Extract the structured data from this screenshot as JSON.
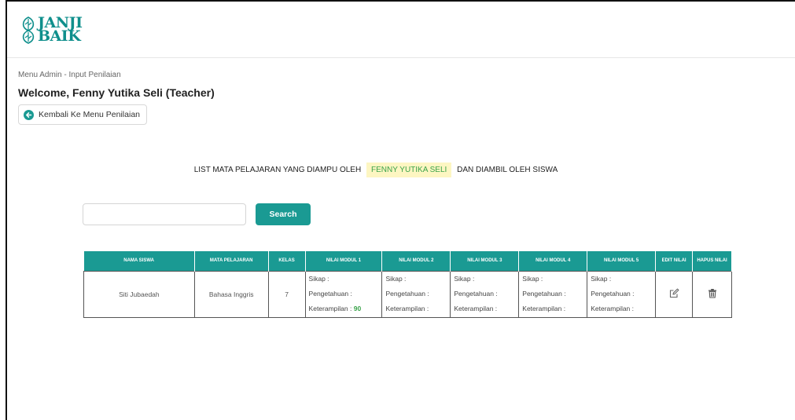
{
  "logo": {
    "line1": "JANJI",
    "line2": "BAIK"
  },
  "breadcrumb": "Menu Admin - Input Penilaian",
  "welcome": "Welcome, Fenny Yutika Seli (Teacher)",
  "back_button": {
    "label": "Kembali Ke Menu Penilaian",
    "icon": "arrow-left-circle-icon"
  },
  "list_title": {
    "prefix": "LIST MATA PELAJARAN YANG DIAMPU OLEH",
    "teacher": "FENNY YUTIKA SELI",
    "suffix": "DAN DIAMBIL OLEH SISWA"
  },
  "search": {
    "placeholder": "",
    "button_label": "Search"
  },
  "table": {
    "headers": [
      "NAMA SISWA",
      "MATA PELAJARAN",
      "KELAS",
      "NILAI MODUL 1",
      "NILAI MODUL 2",
      "NILAI MODUL 3",
      "NILAI MODUL 4",
      "NILAI MODUL 5",
      "EDIT NILAI",
      "HAPUS NILAI"
    ],
    "rows": [
      {
        "nama": "Siti Jubaedah",
        "mapel": "Bahasa Inggris",
        "kelas": "7",
        "modul": [
          {
            "sikap": "Sikap :",
            "pengetahuan": "Pengetahuan :",
            "keterampilan": "Keterampilan :",
            "score": "90"
          },
          {
            "sikap": "Sikap :",
            "pengetahuan": "Pengetahuan :",
            "keterampilan": "Keterampilan :",
            "score": ""
          },
          {
            "sikap": "Sikap :",
            "pengetahuan": "Pengetahuan :",
            "keterampilan": "Keterampilan :",
            "score": ""
          },
          {
            "sikap": "Sikap :",
            "pengetahuan": "Pengetahuan :",
            "keterampilan": "Keterampilan :",
            "score": ""
          },
          {
            "sikap": "Sikap :",
            "pengetahuan": "Pengetahuan :",
            "keterampilan": "Keterampilan :",
            "score": ""
          }
        ],
        "edit_icon": "edit-icon",
        "delete_icon": "trash-icon"
      }
    ]
  },
  "colors": {
    "accent": "#1a9a93",
    "highlight_bg": "#fdf6c2",
    "highlight_text": "#3aa34a"
  }
}
